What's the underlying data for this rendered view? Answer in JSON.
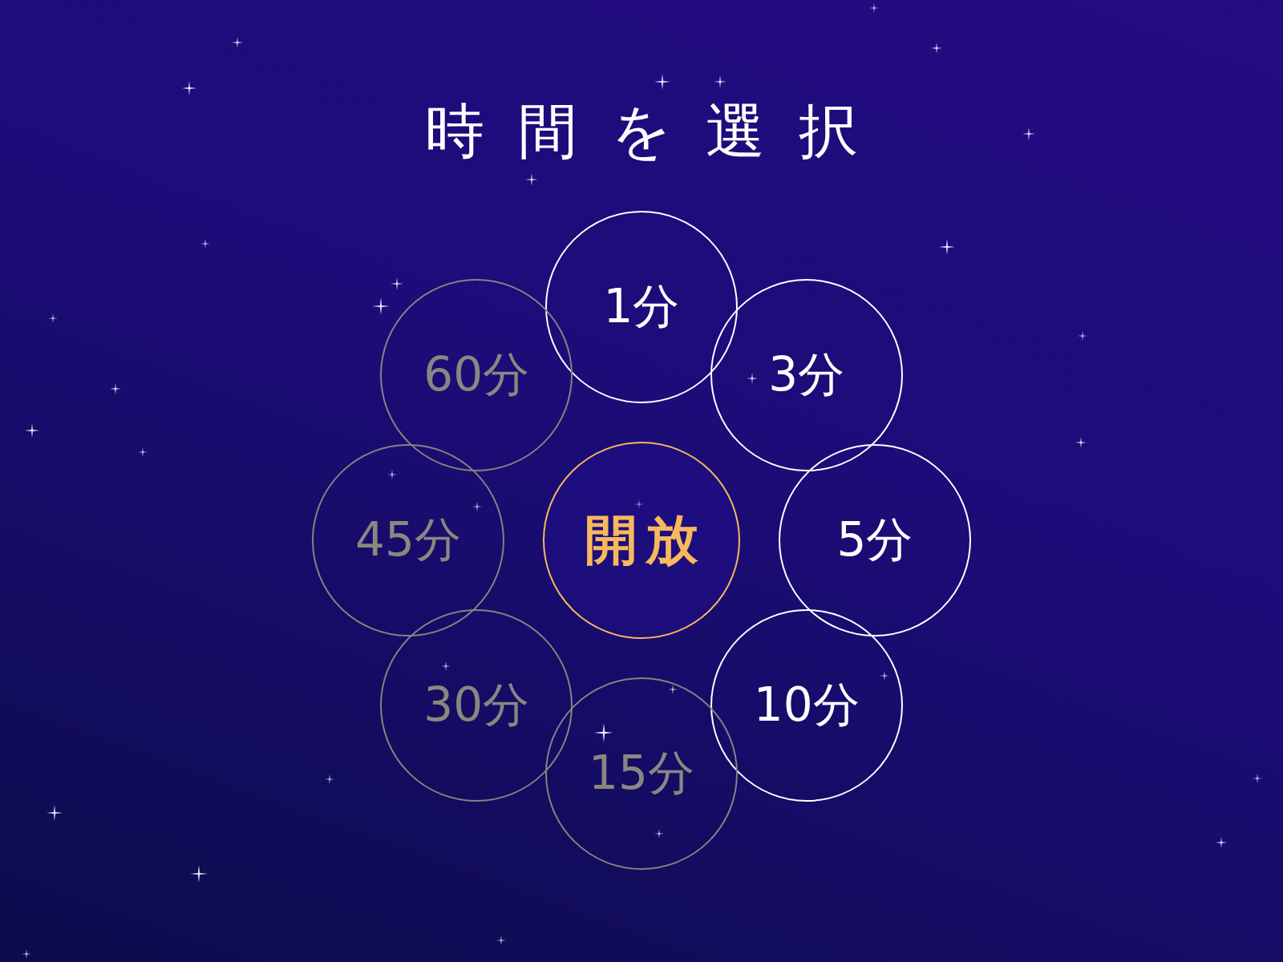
{
  "title": "時間を選択",
  "center_button": {
    "label": "開放"
  },
  "options": [
    {
      "label": "1分",
      "disabled": false
    },
    {
      "label": "3分",
      "disabled": false
    },
    {
      "label": "5分",
      "disabled": false
    },
    {
      "label": "10分",
      "disabled": false
    },
    {
      "label": "15分",
      "disabled": true
    },
    {
      "label": "30分",
      "disabled": true
    },
    {
      "label": "45分",
      "disabled": true
    },
    {
      "label": "60分",
      "disabled": true
    }
  ]
}
